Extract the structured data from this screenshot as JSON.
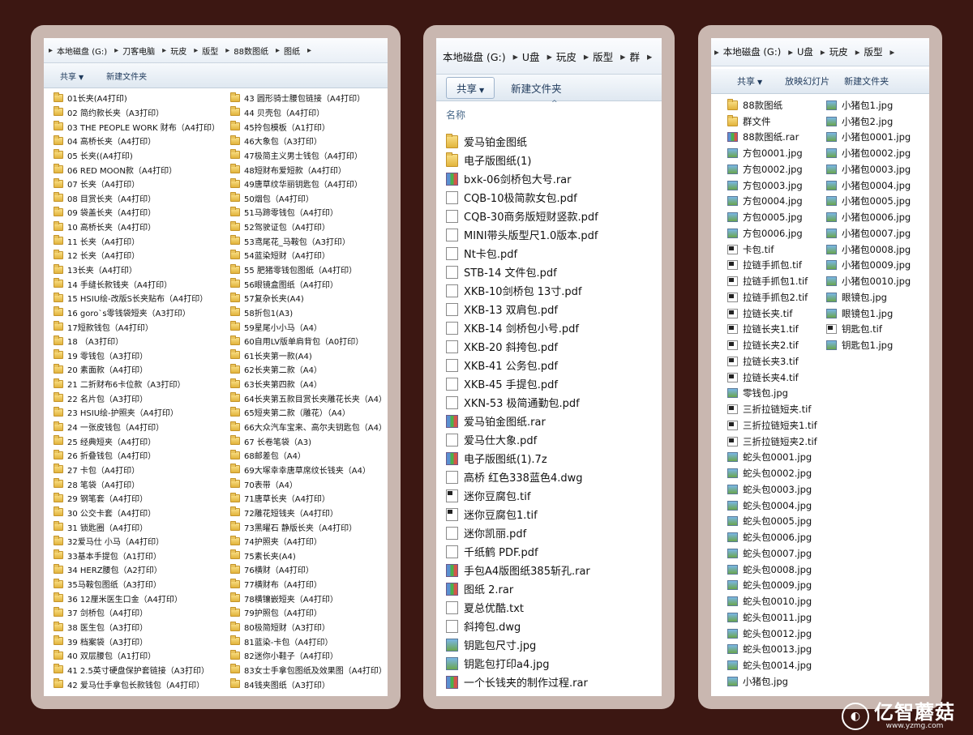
{
  "panel1": {
    "breadcrumb": [
      "本地磁盘 (G:)",
      "刀客电脑",
      "玩皮",
      "版型",
      "88数图纸",
      "图纸"
    ],
    "toolbar": {
      "share": "共享",
      "new_folder": "新建文件夹"
    },
    "col1": [
      "01长夹(A4打印)",
      "02 简约款长夹（A3打印）",
      "03 THE PEOPLE WORK 财布（A4打印）",
      "04 高桥长夹（A4打印）",
      "05 长夹((A4打印)",
      "06 RED MOON款（A4打印）",
      "07 长夹（A4打印）",
      "08 目赏长夹（A4打印）",
      "09 袋盖长夹（A4打印）",
      "10 高桥长夹（A4打印）",
      "11 长夹（A4打印）",
      "12 长夹（A4打印）",
      "13长夹（A4打印）",
      "14 手缝长款钱夹（A4打印）",
      "15 HSIU绘-改版S长夹贴布（A4打印）",
      "16 goro`s零钱袋短夹（A3打印）",
      "17短款钱包（A4打印）",
      "18 （A3打印）",
      "19 零钱包（A3打印）",
      "20 素面款（A4打印）",
      "21 二折财布6卡位款（A3打印）",
      "22 名片包（A3打印）",
      "23 HSIU绘-护照夹（A4打印）",
      "24 一张皮钱包（A4打印）",
      "25 经典短夹（A4打印）",
      "26 折叠钱包（A4打印）",
      "27 卡包（A4打印）",
      "28 笔袋（A4打印）",
      "29 钢笔套（A4打印）",
      "30 公交卡套（A4打印）",
      "31 锁匙圈（A4打印）",
      "32爱马仕 小马（A4打印）",
      "33基本手提包（A1打印）",
      "34 HERZ腰包（A2打印）",
      "35马鞍包图纸（A3打印）",
      "36 12厘米医生口金（A4打印）",
      "37 剑桥包（A4打印）",
      "38 医生包（A3打印）",
      "39 档案袋（A3打印）",
      "40 双层腰包（A1打印）",
      "41 2.5英寸硬盘保护套链接（A3打印）",
      "42 爱马仕手拿包长款钱包（A4打印）"
    ],
    "col2": [
      "43 圆形骑士腰包链接（A4打印）",
      "44 贝壳包（A4打印）",
      "45拎包模板（A1打印）",
      "46大象包（A3打印）",
      "47极简主义男士钱包（A4打印）",
      "48短财布爱短款（A4打印）",
      "49唐草纹华丽钥匙包（A4打印）",
      "50烟包（A4打印）",
      "51马蹄零钱包（A4打印）",
      "52驾驶证包（A4打印）",
      "53鸢尾花_马鞍包（A3打印）",
      "54蓝染短财（A4打印）",
      "55 肥猪零钱包图纸（A4打印）",
      "56眼镜盒图纸（A4打印）",
      "57复杂长夹(A4)",
      "58折包1(A3)",
      "59星尾小小马（A4）",
      "60自用LV版单肩背包（A0打印）",
      "61长夹第一款(A4)",
      "62长夹第二款（A4）",
      "63长夹第四款（A4）",
      "64长夹第五款目赏长夹雕花长夹（A4）",
      "65短夹第二款（雕花）（A4）",
      "66大众汽车宝来、高尔夫钥匙包（A4）",
      "67 长卷笔袋（A3)",
      "68邮差包（A4）",
      "69大塚幸幸唐草席纹长钱夹（A4）",
      "70表带（A4）",
      "71唐草长夹（A4打印）",
      "72雕花短钱夹（A4打印）",
      "73黑曜石 静版长夹（A4打印）",
      "74护照夹（A4打印）",
      "75素长夹(A4)",
      "76横财（A4打印）",
      "77横财布（A4打印）",
      "78横镶嵌短夹（A4打印）",
      "79护照包（A4打印）",
      "80极简短财（A3打印）",
      "81蓝染-卡包（A4打印）",
      "82迷你小鞋子（A4打印）",
      "83女士手拿包图纸及效果图（A4打印）",
      "84钱夹图纸（A3打印）"
    ]
  },
  "panel2": {
    "breadcrumb": [
      "本地磁盘 (G:)",
      "U盘",
      "玩皮",
      "版型",
      "群"
    ],
    "toolbar": {
      "share": "共享",
      "new_folder": "新建文件夹"
    },
    "column_header": "名称",
    "files": [
      {
        "name": "爱马铂金图纸",
        "icon": "folder"
      },
      {
        "name": "电子版图纸(1)",
        "icon": "folder"
      },
      {
        "name": "bxk-06剑桥包大号.rar",
        "icon": "rar"
      },
      {
        "name": "CQB-10极简款女包.pdf",
        "icon": "pdf"
      },
      {
        "name": "CQB-30商务版短财竖款.pdf",
        "icon": "pdf"
      },
      {
        "name": "MINI带头版型尺1.0版本.pdf",
        "icon": "pdf"
      },
      {
        "name": "Nt卡包.pdf",
        "icon": "pdf"
      },
      {
        "name": "STB-14 文件包.pdf",
        "icon": "pdf"
      },
      {
        "name": "XKB-10剑桥包 13寸.pdf",
        "icon": "pdf"
      },
      {
        "name": "XKB-13 双肩包.pdf",
        "icon": "pdf"
      },
      {
        "name": "XKB-14 剑桥包小号.pdf",
        "icon": "pdf"
      },
      {
        "name": "XKB-20 斜挎包.pdf",
        "icon": "pdf"
      },
      {
        "name": "XKB-41 公务包.pdf",
        "icon": "pdf"
      },
      {
        "name": "XKB-45 手提包.pdf",
        "icon": "pdf"
      },
      {
        "name": "XKN-53 极简通勤包.pdf",
        "icon": "pdf"
      },
      {
        "name": "爱马铂金图纸.rar",
        "icon": "rar"
      },
      {
        "name": "爱马仕大象.pdf",
        "icon": "pdf"
      },
      {
        "name": "电子版图纸(1).7z",
        "icon": "rar"
      },
      {
        "name": "高桥 红色338蓝色4.dwg",
        "icon": "dwg"
      },
      {
        "name": "迷你豆腐包.tif",
        "icon": "tif"
      },
      {
        "name": "迷你豆腐包1.tif",
        "icon": "tif"
      },
      {
        "name": "迷你凯丽.pdf",
        "icon": "pdf"
      },
      {
        "name": "千纸鹤 PDF.pdf",
        "icon": "pdf"
      },
      {
        "name": "手包A4版图纸385斩孔.rar",
        "icon": "rar"
      },
      {
        "name": "图纸 2.rar",
        "icon": "rar"
      },
      {
        "name": "夏总优酷.txt",
        "icon": "txt"
      },
      {
        "name": "斜挎包.dwg",
        "icon": "dwg"
      },
      {
        "name": "钥匙包尺寸.jpg",
        "icon": "img"
      },
      {
        "name": "钥匙包打印a4.jpg",
        "icon": "img"
      },
      {
        "name": "一个长钱夹的制作过程.rar",
        "icon": "rar"
      }
    ]
  },
  "panel3": {
    "breadcrumb": [
      "本地磁盘 (G:)",
      "U盘",
      "玩皮",
      "版型"
    ],
    "toolbar": {
      "share": "共享",
      "slideshow": "放映幻灯片",
      "new_folder": "新建文件夹"
    },
    "col1": [
      {
        "name": "88款图纸",
        "icon": "folder"
      },
      {
        "name": "群文件",
        "icon": "folder"
      },
      {
        "name": "88款图纸.rar",
        "icon": "rar"
      },
      {
        "name": "方包0001.jpg",
        "icon": "img"
      },
      {
        "name": "方包0002.jpg",
        "icon": "img"
      },
      {
        "name": "方包0003.jpg",
        "icon": "img"
      },
      {
        "name": "方包0004.jpg",
        "icon": "img"
      },
      {
        "name": "方包0005.jpg",
        "icon": "img"
      },
      {
        "name": "方包0006.jpg",
        "icon": "img"
      },
      {
        "name": "卡包.tif",
        "icon": "tif"
      },
      {
        "name": "拉链手抓包.tif",
        "icon": "tif"
      },
      {
        "name": "拉链手抓包1.tif",
        "icon": "tif"
      },
      {
        "name": "拉链手抓包2.tif",
        "icon": "tif"
      },
      {
        "name": "拉链长夹.tif",
        "icon": "tif"
      },
      {
        "name": "拉链长夹1.tif",
        "icon": "tif"
      },
      {
        "name": "拉链长夹2.tif",
        "icon": "tif"
      },
      {
        "name": "拉链长夹3.tif",
        "icon": "tif"
      },
      {
        "name": "拉链长夹4.tif",
        "icon": "tif"
      },
      {
        "name": "零钱包.jpg",
        "icon": "img"
      },
      {
        "name": "三折拉链短夹.tif",
        "icon": "tif"
      },
      {
        "name": "三折拉链短夹1.tif",
        "icon": "tif"
      },
      {
        "name": "三折拉链短夹2.tif",
        "icon": "tif"
      },
      {
        "name": "蛇头包0001.jpg",
        "icon": "img"
      },
      {
        "name": "蛇头包0002.jpg",
        "icon": "img"
      },
      {
        "name": "蛇头包0003.jpg",
        "icon": "img"
      },
      {
        "name": "蛇头包0004.jpg",
        "icon": "img"
      },
      {
        "name": "蛇头包0005.jpg",
        "icon": "img"
      },
      {
        "name": "蛇头包0006.jpg",
        "icon": "img"
      },
      {
        "name": "蛇头包0007.jpg",
        "icon": "img"
      },
      {
        "name": "蛇头包0008.jpg",
        "icon": "img"
      },
      {
        "name": "蛇头包0009.jpg",
        "icon": "img"
      },
      {
        "name": "蛇头包0010.jpg",
        "icon": "img"
      },
      {
        "name": "蛇头包0011.jpg",
        "icon": "img"
      },
      {
        "name": "蛇头包0012.jpg",
        "icon": "img"
      },
      {
        "name": "蛇头包0013.jpg",
        "icon": "img"
      },
      {
        "name": "蛇头包0014.jpg",
        "icon": "img"
      },
      {
        "name": "小猪包.jpg",
        "icon": "img"
      }
    ],
    "col2": [
      {
        "name": "小猪包1.jpg",
        "icon": "img"
      },
      {
        "name": "小猪包2.jpg",
        "icon": "img"
      },
      {
        "name": "小猪包0001.jpg",
        "icon": "img"
      },
      {
        "name": "小猪包0002.jpg",
        "icon": "img"
      },
      {
        "name": "小猪包0003.jpg",
        "icon": "img"
      },
      {
        "name": "小猪包0004.jpg",
        "icon": "img"
      },
      {
        "name": "小猪包0005.jpg",
        "icon": "img"
      },
      {
        "name": "小猪包0006.jpg",
        "icon": "img"
      },
      {
        "name": "小猪包0007.jpg",
        "icon": "img"
      },
      {
        "name": "小猪包0008.jpg",
        "icon": "img"
      },
      {
        "name": "小猪包0009.jpg",
        "icon": "img"
      },
      {
        "name": "小猪包0010.jpg",
        "icon": "img"
      },
      {
        "name": "眼镜包.jpg",
        "icon": "img"
      },
      {
        "name": "眼镜包1.jpg",
        "icon": "img"
      },
      {
        "name": "钥匙包.tif",
        "icon": "tif"
      },
      {
        "name": "钥匙包1.jpg",
        "icon": "img"
      }
    ]
  },
  "watermark": {
    "logo_glyph": "◐",
    "title": "亿智蘑菇",
    "url": "www.yzmg.com"
  }
}
